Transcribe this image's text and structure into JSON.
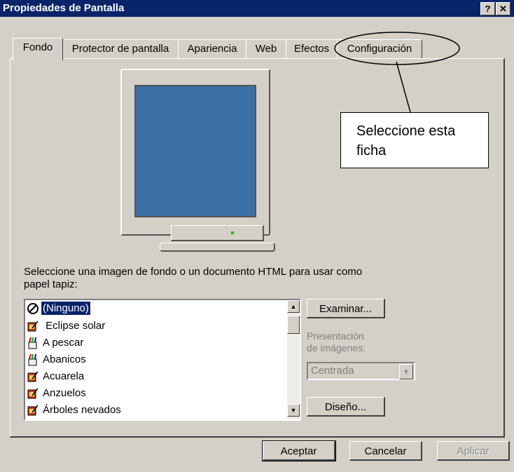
{
  "window": {
    "title": "Propiedades de Pantalla",
    "help_glyph": "?",
    "close_glyph": "✕"
  },
  "tabs": [
    {
      "label": "Fondo",
      "active": true
    },
    {
      "label": "Protector de pantalla"
    },
    {
      "label": "Apariencia"
    },
    {
      "label": "Web"
    },
    {
      "label": "Efectos"
    },
    {
      "label": "Configuración"
    }
  ],
  "callout": {
    "line1": "Seleccione esta",
    "line2": "ficha"
  },
  "prompt": {
    "line1": "Seleccione una imagen de fondo o un documento HTML para usar como",
    "line2": "papel tapiz:"
  },
  "wallpapers": [
    {
      "label": "(Ninguno)",
      "selected": true,
      "icon": "none-icon"
    },
    {
      "label": " Eclipse solar",
      "icon": "image-icon"
    },
    {
      "label": "A pescar",
      "icon": "html-icon"
    },
    {
      "label": "Abanicos",
      "icon": "html-icon"
    },
    {
      "label": "Acuarela",
      "icon": "image-icon"
    },
    {
      "label": "Anzuelos",
      "icon": "image-icon"
    },
    {
      "label": "Árboles nevados",
      "icon": "image-icon"
    }
  ],
  "buttons": {
    "browse": "Examinar...",
    "pattern": "Diseño...",
    "ok": "Aceptar",
    "cancel": "Cancelar",
    "apply": "Aplicar"
  },
  "display": {
    "label_line1": "Presentación",
    "label_line2": "de imágenes:",
    "value": "Centrada"
  },
  "colors": {
    "title_bar": "#0a246a",
    "desktop": "#3a6ea5",
    "face": "#d4d0c8"
  }
}
